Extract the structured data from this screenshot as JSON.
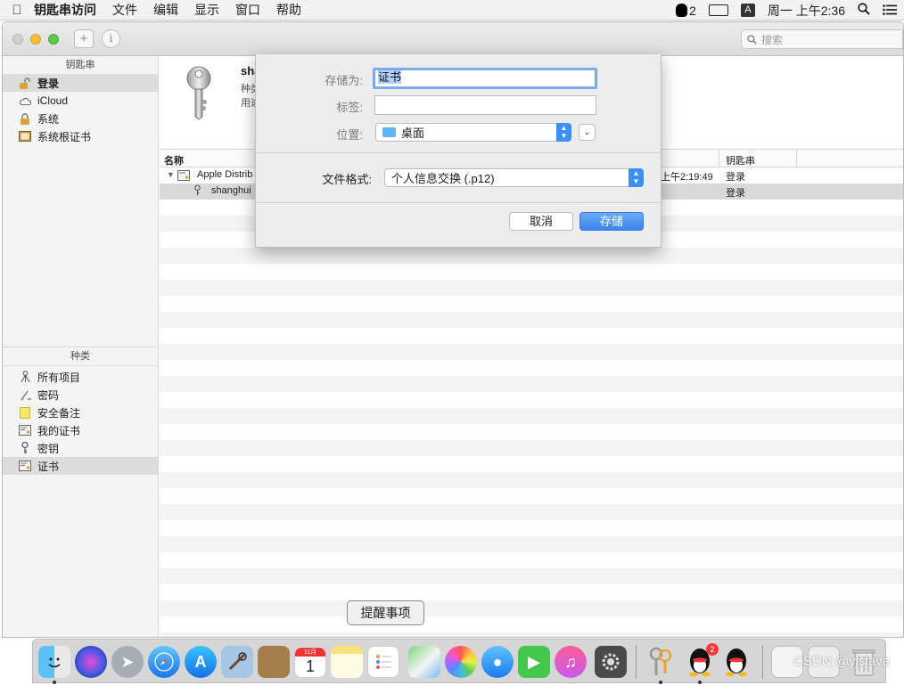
{
  "menubar": {
    "app_name": "钥匙串访问",
    "menus": [
      "文件",
      "编辑",
      "显示",
      "窗口",
      "帮助"
    ],
    "qq_count": "2",
    "input_method": "A",
    "clock": "周一 上午2:36"
  },
  "toolbar": {
    "add_label": "+",
    "info_label": "i",
    "search_placeholder": "搜索"
  },
  "sidebar": {
    "keychains_header": "钥匙串",
    "keychains": [
      {
        "label": "登录",
        "icon": "lock-open-icon",
        "selected": true
      },
      {
        "label": "iCloud",
        "icon": "cloud-icon",
        "selected": false
      },
      {
        "label": "系统",
        "icon": "lock-icon",
        "selected": false
      },
      {
        "label": "系统根证书",
        "icon": "cabinet-icon",
        "selected": false
      }
    ],
    "category_header": "种类",
    "categories": [
      {
        "label": "所有项目",
        "icon": "all-items-icon",
        "selected": false
      },
      {
        "label": "密码",
        "icon": "password-icon",
        "selected": false
      },
      {
        "label": "安全备注",
        "icon": "note-icon",
        "selected": false
      },
      {
        "label": "我的证书",
        "icon": "certificate-icon",
        "selected": false
      },
      {
        "label": "密钥",
        "icon": "key-icon",
        "selected": false
      },
      {
        "label": "证书",
        "icon": "certificate-icon",
        "selected": true
      }
    ]
  },
  "detail": {
    "title": "sha",
    "kind_label": "种类",
    "usage_label": "用途"
  },
  "table": {
    "columns": [
      "名称",
      "钥匙串"
    ],
    "rows": [
      {
        "name": "Apple Distrib",
        "date": "上午2:19:49",
        "keychain": "登录"
      },
      {
        "name": "shanghui",
        "date": "",
        "keychain": "登录"
      }
    ]
  },
  "save_sheet": {
    "save_as_label": "存储为:",
    "save_as_value": "证书",
    "tags_label": "标签:",
    "tags_value": "",
    "location_label": "位置:",
    "location_value": "桌面",
    "format_label": "文件格式:",
    "format_value": "个人信息交换 (.p12)",
    "cancel_label": "取消",
    "save_label": "存储"
  },
  "tooltip": "提醒事项",
  "dock": {
    "calendar_month": "11月",
    "calendar_day": "1",
    "qq_badge": "2"
  },
  "watermark": "CSDN @yjsjava"
}
